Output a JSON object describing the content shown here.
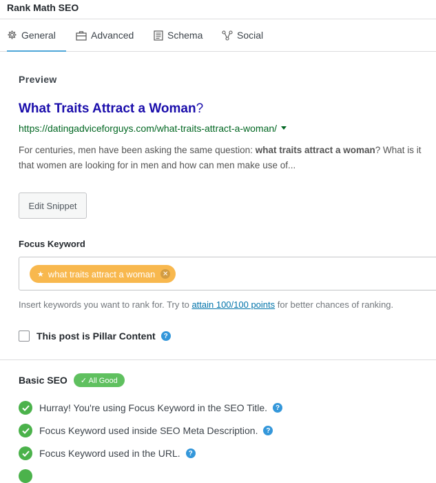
{
  "header": {
    "title": "Rank Math SEO"
  },
  "tabs": [
    {
      "label": "General",
      "icon": "gear-icon"
    },
    {
      "label": "Advanced",
      "icon": "briefcase-icon"
    },
    {
      "label": "Schema",
      "icon": "schema-icon"
    },
    {
      "label": "Social",
      "icon": "share-icon"
    }
  ],
  "preview": {
    "label": "Preview",
    "title": "What Traits Attract a Woman",
    "title_suffix": "?",
    "url": "https://datingadviceforguys.com/what-traits-attract-a-woman/",
    "desc_pre": "For centuries, men have been asking the same question: ",
    "desc_bold": "what traits attract a woman",
    "desc_post": "? What is it that women are looking for in men and how can men make use of..."
  },
  "edit_snippet": "Edit Snippet",
  "focus": {
    "label": "Focus Keyword",
    "keyword": "what traits attract a woman",
    "hint_pre": "Insert keywords you want to rank for. Try to ",
    "hint_link": "attain 100/100 points",
    "hint_post": " for better chances of ranking."
  },
  "pillar": {
    "label": "This post is Pillar Content",
    "checked": false
  },
  "basic_seo": {
    "label": "Basic SEO",
    "badge": "✓ All Good",
    "checks": [
      "Hurray! You're using Focus Keyword in the SEO Title.",
      "Focus Keyword used inside SEO Meta Description.",
      "Focus Keyword used in the URL."
    ]
  },
  "colors": {
    "accent": "#4ea6d8",
    "link": "#1a0dab",
    "url": "#006621",
    "keyword": "#f8b84e",
    "good": "#4bb24b"
  }
}
